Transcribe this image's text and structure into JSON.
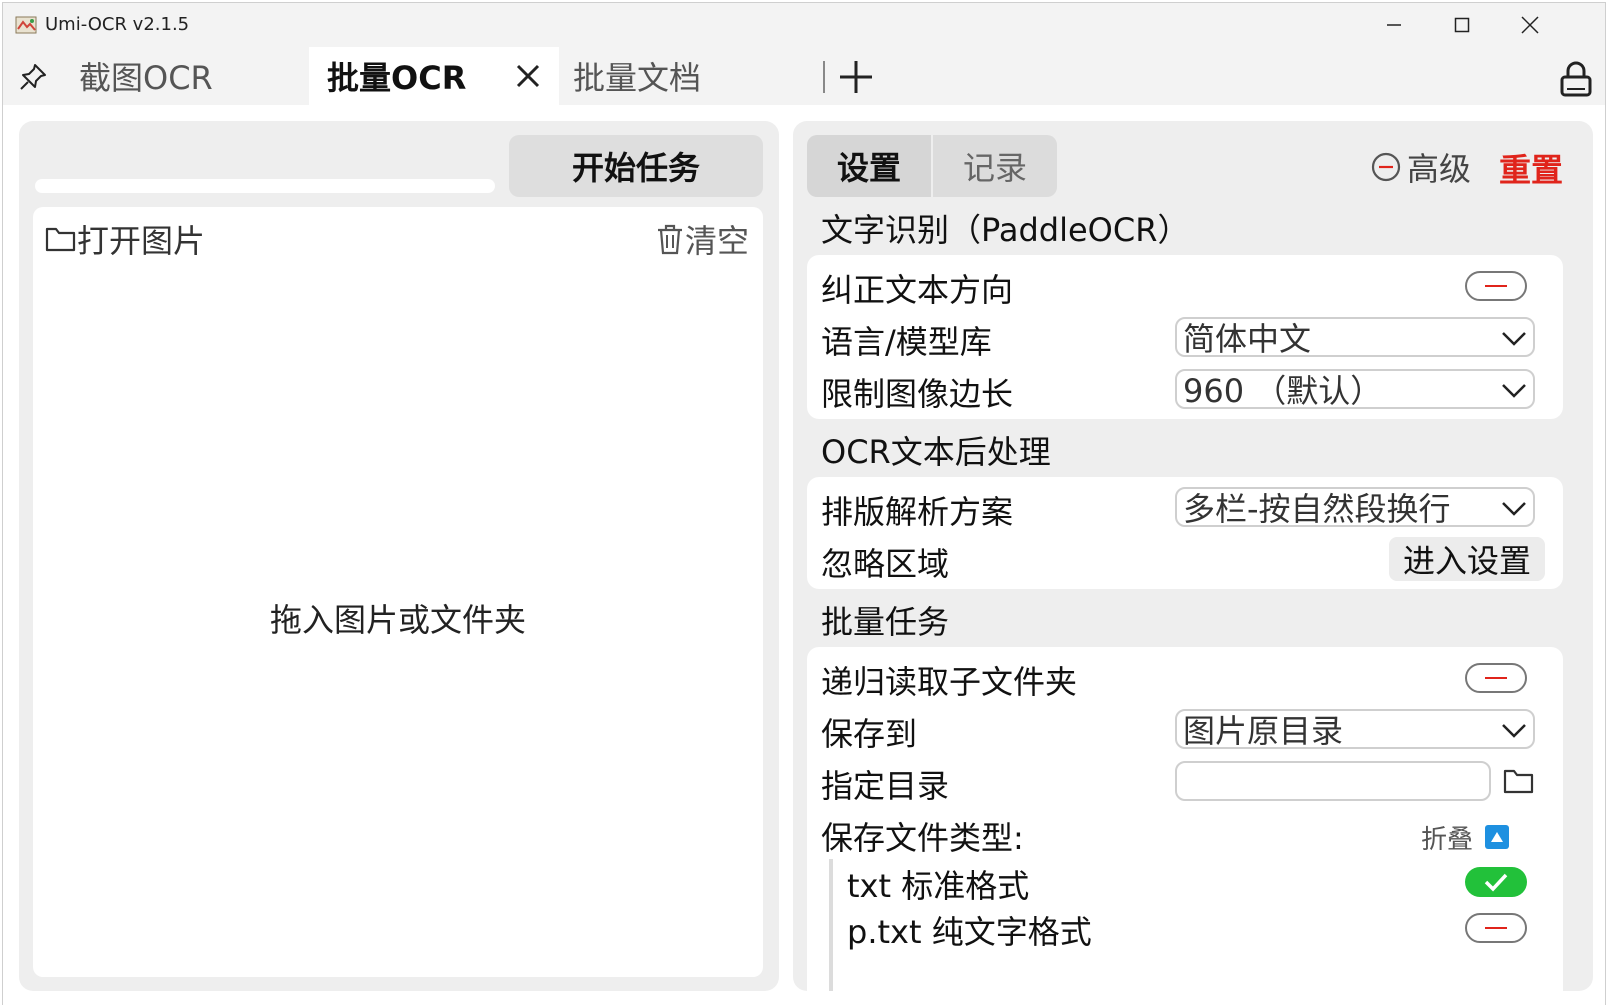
{
  "window": {
    "title": "Umi-OCR v2.1.5"
  },
  "tabs": [
    {
      "label": "截图OCR",
      "active": false
    },
    {
      "label": "批量OCR",
      "active": true
    },
    {
      "label": "批量文档",
      "active": false
    }
  ],
  "left": {
    "start_button": "开始任务",
    "open_images": "打开图片",
    "clear": "清空",
    "drop_hint": "拖入图片或文件夹",
    "progress": 0
  },
  "right": {
    "tabs": {
      "settings": "设置",
      "records": "记录"
    },
    "advanced": "高级",
    "reset": "重置",
    "sections": {
      "ocr": {
        "title": "文字识别（PaddleOCR）",
        "correct_direction": {
          "label": "纠正文本方向",
          "enabled": false
        },
        "language": {
          "label": "语言/模型库",
          "value": "简体中文"
        },
        "limit_side": {
          "label": "限制图像边长",
          "value": "960 （默认）"
        }
      },
      "post": {
        "title": "OCR文本后处理",
        "layout": {
          "label": "排版解析方案",
          "value": "多栏-按自然段换行"
        },
        "ignore_area": {
          "label": "忽略区域",
          "button": "进入设置"
        }
      },
      "batch": {
        "title": "批量任务",
        "recursive": {
          "label": "递归读取子文件夹",
          "enabled": false
        },
        "save_to": {
          "label": "保存到",
          "value": "图片原目录"
        },
        "custom_dir": {
          "label": "指定目录",
          "value": ""
        },
        "file_types": {
          "label": "保存文件类型:",
          "collapse": "折叠",
          "items": [
            {
              "label": "txt 标准格式",
              "enabled": true
            },
            {
              "label": "p.txt 纯文字格式",
              "enabled": false
            }
          ]
        }
      }
    }
  },
  "colors": {
    "reset_red": "#e0241b",
    "toggle_on": "#22c13a",
    "collapse_blue": "#1e90e0"
  }
}
